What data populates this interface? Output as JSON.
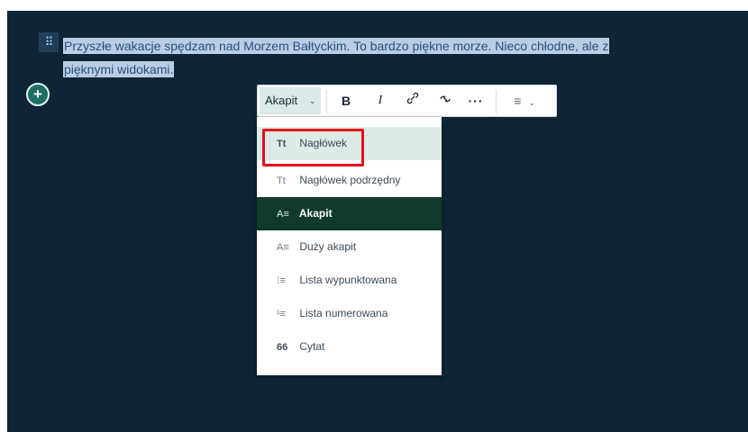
{
  "editor": {
    "drag_handle_glyph": "⠿",
    "paragraph_line1": "Przyszłe wakacje spędzam nad Morzem Bałtyckim. To bardzo piękne morze. Nieco chłodne, ale z",
    "paragraph_line2": "pięknymi widokami.",
    "add_block_glyph": "+"
  },
  "toolbar": {
    "style_select_label": "Akapit",
    "style_select_chevron": "⌄",
    "bold_glyph": "B",
    "italic_glyph": "I",
    "link_glyph": "🔗",
    "unlink_glyph": "⛓",
    "more_glyph": "···",
    "align_glyph": "≡",
    "align_chevron": "⌄"
  },
  "style_menu": {
    "items": [
      {
        "icon": "Tt",
        "label": "Nagłówek",
        "state": "hover"
      },
      {
        "icon": "Tt",
        "label": "Nagłówek podrzędny",
        "state": "normal"
      },
      {
        "icon": "A≡",
        "label": "Akapit",
        "state": "active"
      },
      {
        "icon": "A≡",
        "label": "Duży akapit",
        "state": "normal"
      },
      {
        "icon": "⁝≡",
        "label": "Lista wypunktowana",
        "state": "normal"
      },
      {
        "icon": "¹≡",
        "label": "Lista numerowana",
        "state": "normal"
      },
      {
        "icon": "66",
        "label": "Cytat",
        "state": "normal"
      }
    ]
  },
  "colors": {
    "canvas_bg": "#0e2538",
    "selection": "#b9cde4",
    "accent": "#0f3a2c",
    "highlight_box": "#e3101b"
  }
}
